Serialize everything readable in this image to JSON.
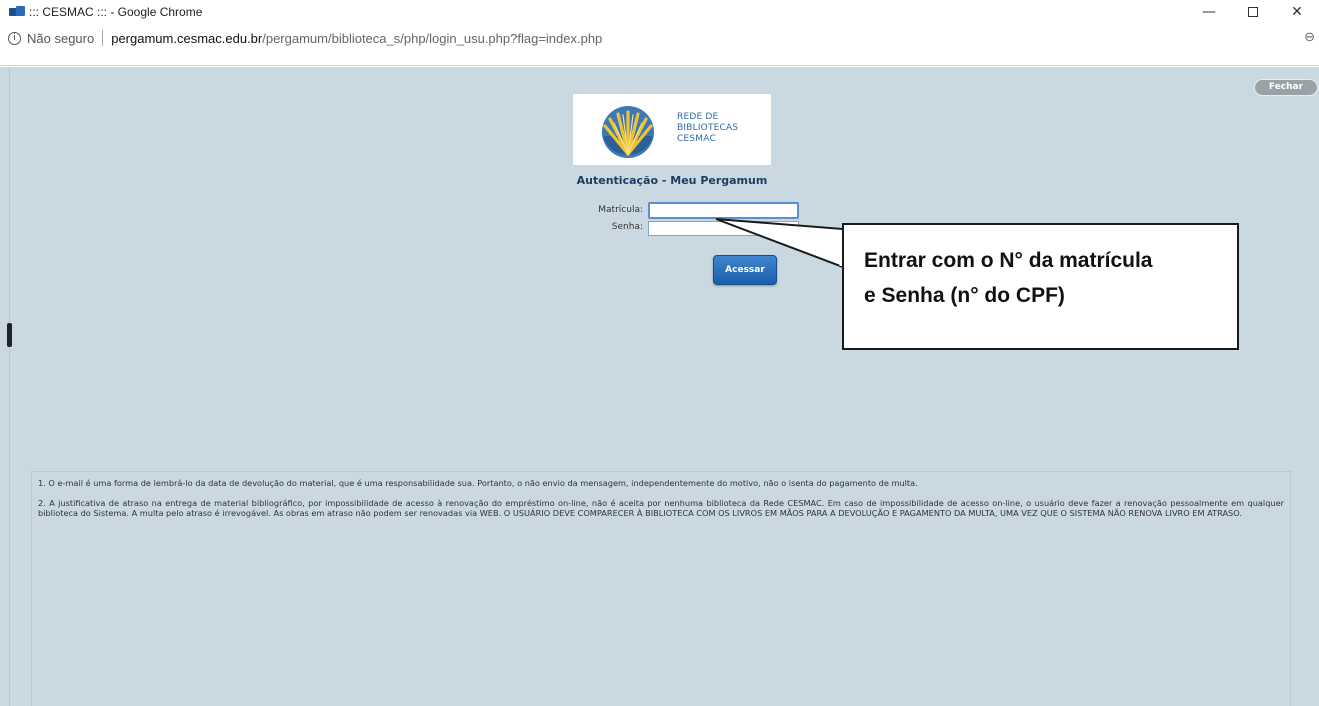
{
  "window": {
    "title": "::: CESMAC ::: - Google Chrome",
    "controls": {
      "minimize": "—",
      "close": "✕"
    }
  },
  "address_bar": {
    "info_icon": "i",
    "security_label": "Não seguro",
    "url_host": "pergamum.cesmac.edu.br",
    "url_path": "/pergamum/biblioteca_s/php/login_usu.php?flag=index.php",
    "zoom_icon": "⊖"
  },
  "page": {
    "close_button": "Fechar",
    "logo": {
      "line1": "REDE DE",
      "line2": "BIBLIOTECAS",
      "line3": "CESMAC"
    },
    "title": "Autenticação - Meu Pergamum",
    "form": {
      "matricula_label": "Matrícula:",
      "matricula_value": "",
      "senha_label": "Senha:",
      "senha_value": "",
      "submit": "Acessar"
    },
    "callout": {
      "line1": "Entrar com o N° da matrícula",
      "line2": "e Senha (n° do CPF)"
    },
    "notes": [
      "1. O e-mail é uma forma de lembrá-lo da data de devolução do material, que é uma responsabilidade sua. Portanto, o não envio da mensagem, independentemente do motivo, não o isenta do pagamento de multa.",
      "2. A justificativa de atraso na entrega de material bibliográfico, por impossibilidade de acesso à renovação do empréstimo on-line, não é aceita por nenhuma biblioteca da Rede CESMAC. Em caso de impossibilidade de acesso on-line, o usuário deve fazer a renovação pessoalmente em qualquer biblioteca do Sistema. A multa pelo atraso é irrevogável. As obras em atraso não podem ser renovadas via WEB. O USUÁRIO DEVE COMPARECER À BIBLIOTECA COM OS LIVROS EM MÃOS PARA A DEVOLUÇÃO E PAGAMENTO DA MULTA, UMA VEZ QUE O SISTEMA NÃO RENOVA LIVRO EM ATRASO."
    ]
  }
}
